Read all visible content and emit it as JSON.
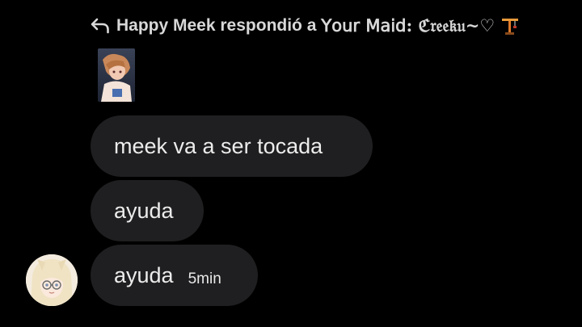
{
  "reply": {
    "icon": "reply-arrow-icon",
    "text": "Happy Meek respondió a",
    "target": "𝖸𝗈𝗎𝗋 𝖬𝖺𝗂𝖽: ℭ𝔯𝔢𝔢𝔨𝔲~♡",
    "emoji": "crane-icon"
  },
  "quoted_media": {
    "kind": "anime-art-thumbnail"
  },
  "messages": [
    {
      "text": "meek va a ser tocada"
    },
    {
      "text": "ayuda"
    },
    {
      "text": "ayuda",
      "time": "5min"
    }
  ],
  "sender": {
    "avatar": "anime-girl-avatar"
  },
  "colors": {
    "background": "#000000",
    "bubble": "#1f1f21",
    "text": "#ececec",
    "reply_text": "#d8d8d8"
  }
}
